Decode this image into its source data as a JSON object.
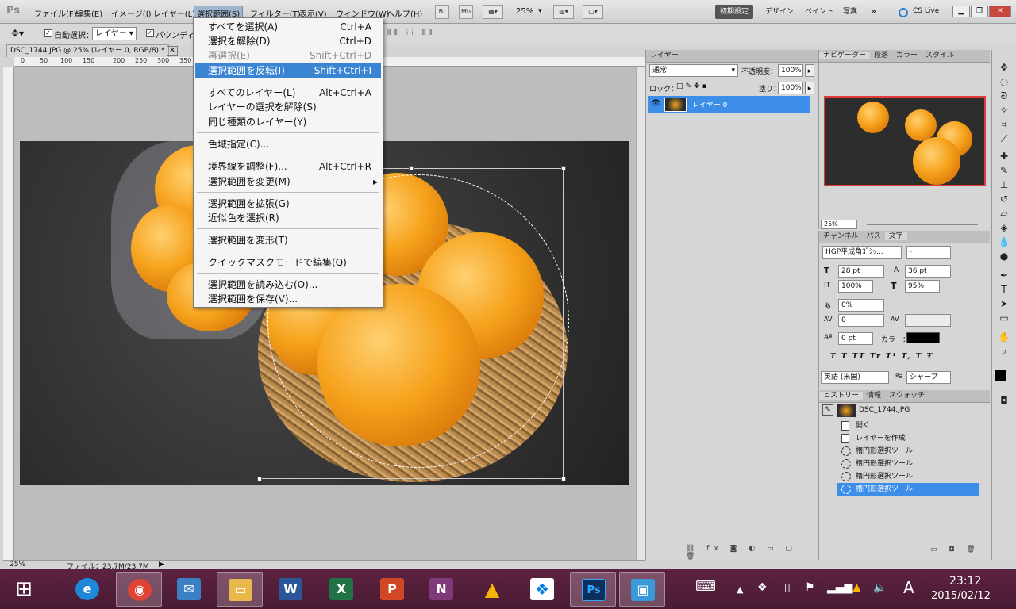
{
  "app": {
    "logo": "Ps"
  },
  "menubar": {
    "items": [
      "ファイル(F)",
      "編集(E)",
      "イメージ(I)",
      "レイヤー(L)",
      "選択範囲(S)",
      "フィルター(T)",
      "表示(V)",
      "ウィンドウ(W)",
      "ヘルプ(H)"
    ],
    "active_index": 4,
    "app_buttons": [
      "Br",
      "Mb"
    ],
    "zoom": "25%",
    "workspaces": [
      "初期設定",
      "デザイン",
      "ペイント",
      "写真"
    ],
    "more": "»",
    "cs_live": "CS Live"
  },
  "options": {
    "auto_select_label": "自動選択：",
    "auto_select_value": "レイヤー",
    "bounding_label": "バウンディング"
  },
  "document": {
    "tab_title": "DSC_1744.JPG @ 25% (レイヤー 0, RGB/8) *",
    "ruler_marks": [
      "0",
      "50",
      "100",
      "150",
      "200",
      "250",
      "300",
      "350"
    ],
    "zoom_status": "25%",
    "file_status": "ファイル：23.7M/23.7M"
  },
  "select_menu": {
    "items": [
      {
        "label": "すべてを選択(A)",
        "shortcut": "Ctrl+A",
        "state": "normal"
      },
      {
        "label": "選択を解除(D)",
        "shortcut": "Ctrl+D",
        "state": "normal"
      },
      {
        "label": "再選択(E)",
        "shortcut": "Shift+Ctrl+D",
        "state": "disabled"
      },
      {
        "label": "選択範囲を反転(I)",
        "shortcut": "Shift+Ctrl+I",
        "state": "highlighted"
      },
      {
        "label": "すべてのレイヤー(L)",
        "shortcut": "Alt+Ctrl+A",
        "state": "normal"
      },
      {
        "label": "レイヤーの選択を解除(S)",
        "shortcut": "",
        "state": "normal"
      },
      {
        "label": "同じ種類のレイヤー(Y)",
        "shortcut": "",
        "state": "normal"
      },
      {
        "label": "色域指定(C)...",
        "shortcut": "",
        "state": "normal"
      },
      {
        "label": "境界線を調整(F)...",
        "shortcut": "Alt+Ctrl+R",
        "state": "normal"
      },
      {
        "label": "選択範囲を変更(M)",
        "shortcut": "▸",
        "state": "normal"
      },
      {
        "label": "選択範囲を拡張(G)",
        "shortcut": "",
        "state": "normal"
      },
      {
        "label": "近似色を選択(R)",
        "shortcut": "",
        "state": "normal"
      },
      {
        "label": "選択範囲を変形(T)",
        "shortcut": "",
        "state": "normal"
      },
      {
        "label": "クイックマスクモードで編集(Q)",
        "shortcut": "",
        "state": "normal"
      },
      {
        "label": "選択範囲を読み込む(O)...",
        "shortcut": "",
        "state": "normal"
      },
      {
        "label": "選択範囲を保存(V)...",
        "shortcut": "",
        "state": "normal"
      }
    ]
  },
  "layers": {
    "tab": "レイヤー",
    "blend_mode": "通常",
    "opacity_label": "不透明度：",
    "opacity": "100%",
    "lock_label": "ロック：",
    "fill_label": "塗り：",
    "fill": "100%",
    "layer_name": "レイヤー 0"
  },
  "navigator": {
    "tabs": [
      "ナビゲーター",
      "段落",
      "カラー",
      "スタイル"
    ],
    "zoom": "25%"
  },
  "character": {
    "tabs": [
      "チャンネル",
      "パス",
      "文字"
    ],
    "font": "HGP平成角ｺﾞｼｯ...",
    "style": "-",
    "size": "28 pt",
    "leading": "36 pt",
    "v_scale": "100%",
    "h_scale": "95%",
    "tsume": "0%",
    "kerning": "0",
    "baseline": "0 pt",
    "color_label": "カラー：",
    "text_color": "#000000",
    "styles": [
      "T",
      "T",
      "TT",
      "Tr",
      "T¹",
      "T,",
      "T",
      "Ŧ"
    ],
    "language": "英語 (米国)",
    "aa_label": "ªa",
    "antialias": "シャープ"
  },
  "history": {
    "tabs": [
      "ヒストリー",
      "情報",
      "スウォッチ"
    ],
    "snapshot": "DSC_1744.JPG",
    "items": [
      {
        "label": "開く",
        "icon": "doc"
      },
      {
        "label": "レイヤーを作成",
        "icon": "doc"
      },
      {
        "label": "楕円形選択ツール",
        "icon": "ellipse"
      },
      {
        "label": "楕円形選択ツール",
        "icon": "ellipse"
      },
      {
        "label": "楕円形選択ツール",
        "icon": "ellipse"
      },
      {
        "label": "楕円形選択ツール",
        "icon": "ellipse"
      }
    ],
    "selected_index": 5
  },
  "taskbar": {
    "time": "23:12",
    "date": "2015/02/12",
    "ime": "A",
    "apps": [
      {
        "name": "internet-explorer",
        "glyph": "e",
        "color": "#1e88d8"
      },
      {
        "name": "chrome",
        "glyph": "◉",
        "color": "#e04236"
      },
      {
        "name": "outlook-mail",
        "glyph": "✉",
        "color": "#3b7fc4"
      },
      {
        "name": "explorer",
        "glyph": "▭",
        "color": "#e8b84a"
      },
      {
        "name": "word",
        "glyph": "W",
        "color": "#2b579a"
      },
      {
        "name": "excel",
        "glyph": "X",
        "color": "#217346"
      },
      {
        "name": "powerpoint",
        "glyph": "P",
        "color": "#d24726"
      },
      {
        "name": "onenote",
        "glyph": "N",
        "color": "#80397b"
      },
      {
        "name": "google-drive",
        "glyph": "▲",
        "color": "#f4b400"
      },
      {
        "name": "dropbox",
        "glyph": "❖",
        "color": "#007ee5"
      },
      {
        "name": "photoshop",
        "glyph": "Ps",
        "color": "#0e2f5a"
      },
      {
        "name": "remote-desktop",
        "glyph": "▣",
        "color": "#3a9ad9"
      }
    ]
  }
}
